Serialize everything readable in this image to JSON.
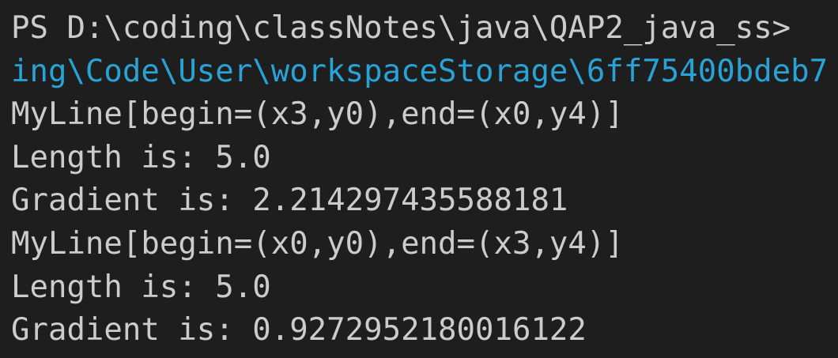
{
  "terminal": {
    "background": "#1e1e1e",
    "text_color": "#cccccc",
    "link_color": "#29a3d6",
    "lines": [
      "PS D:\\coding\\classNotes\\java\\QAP2_java_ss>",
      "ing\\Code\\User\\workspaceStorage\\6ff75400bdeb7",
      "MyLine[begin=(x3,y0),end=(x0,y4)]",
      "Length is: 5.0",
      "Gradient is: 2.214297435588181",
      "MyLine[begin=(x0,y0),end=(x3,y4)]",
      "Length is: 5.0",
      "Gradient is: 0.9272952180016122"
    ]
  }
}
